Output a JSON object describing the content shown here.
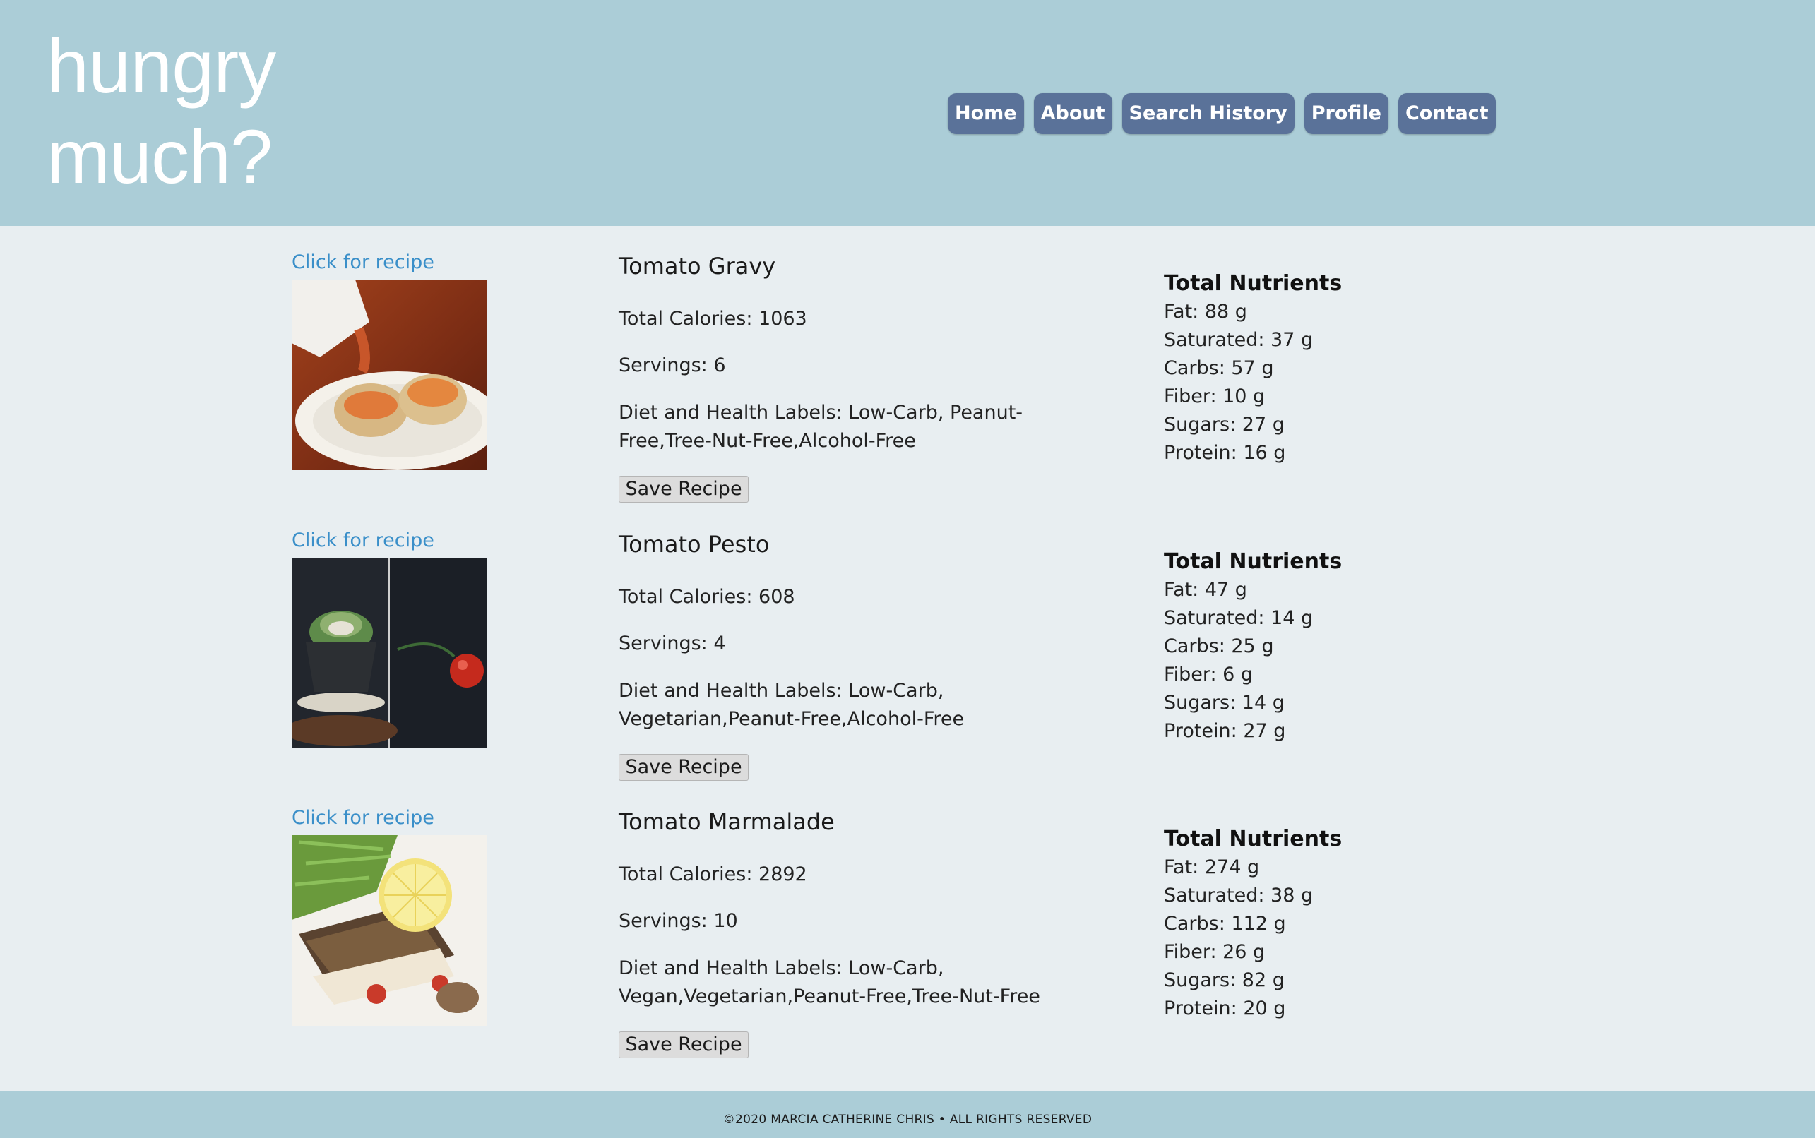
{
  "header": {
    "logo_line1": "hungry",
    "logo_line2": "much?",
    "nav": [
      "Home",
      "About",
      "Search History",
      "Profile",
      "Contact"
    ]
  },
  "recipes": [
    {
      "link": "Click for recipe",
      "title": "Tomato Gravy",
      "calories": "Total Calories: 1063",
      "servings": "Servings: 6",
      "labels": "Diet and Health Labels: Low-Carb, Peanut-Free,Tree-Nut-Free,Alcohol-Free",
      "save": "Save Recipe",
      "nutrients_title": "Total Nutrients",
      "nutrients": [
        "Fat: 88 g",
        "Saturated: 37 g",
        "Carbs: 57 g",
        "Fiber: 10 g",
        "Sugars: 27 g",
        "Protein: 16 g"
      ]
    },
    {
      "link": "Click for recipe",
      "title": "Tomato Pesto",
      "calories": "Total Calories: 608",
      "servings": "Servings: 4",
      "labels": "Diet and Health Labels: Low-Carb, Vegetarian,Peanut-Free,Alcohol-Free",
      "save": "Save Recipe",
      "nutrients_title": "Total Nutrients",
      "nutrients": [
        "Fat: 47 g",
        "Saturated: 14 g",
        "Carbs: 25 g",
        "Fiber: 6 g",
        "Sugars: 14 g",
        "Protein: 27 g"
      ]
    },
    {
      "link": "Click for recipe",
      "title": "Tomato Marmalade",
      "calories": "Total Calories: 2892",
      "servings": "Servings: 10",
      "labels": "Diet and Health Labels: Low-Carb, Vegan,Vegetarian,Peanut-Free,Tree-Nut-Free",
      "save": "Save Recipe",
      "nutrients_title": "Total Nutrients",
      "nutrients": [
        "Fat: 274 g",
        "Saturated: 38 g",
        "Carbs: 112 g",
        "Fiber: 26 g",
        "Sugars: 82 g",
        "Protein: 20 g"
      ]
    }
  ],
  "footer": {
    "text": "©2020 MARCIA CATHERINE CHRIS • ALL RIGHTS RESERVED"
  },
  "colors": {
    "header_bg": "#abcdd7",
    "page_bg": "#e8eef1",
    "nav_button": "#5a7299",
    "link": "#3a8fc9"
  }
}
